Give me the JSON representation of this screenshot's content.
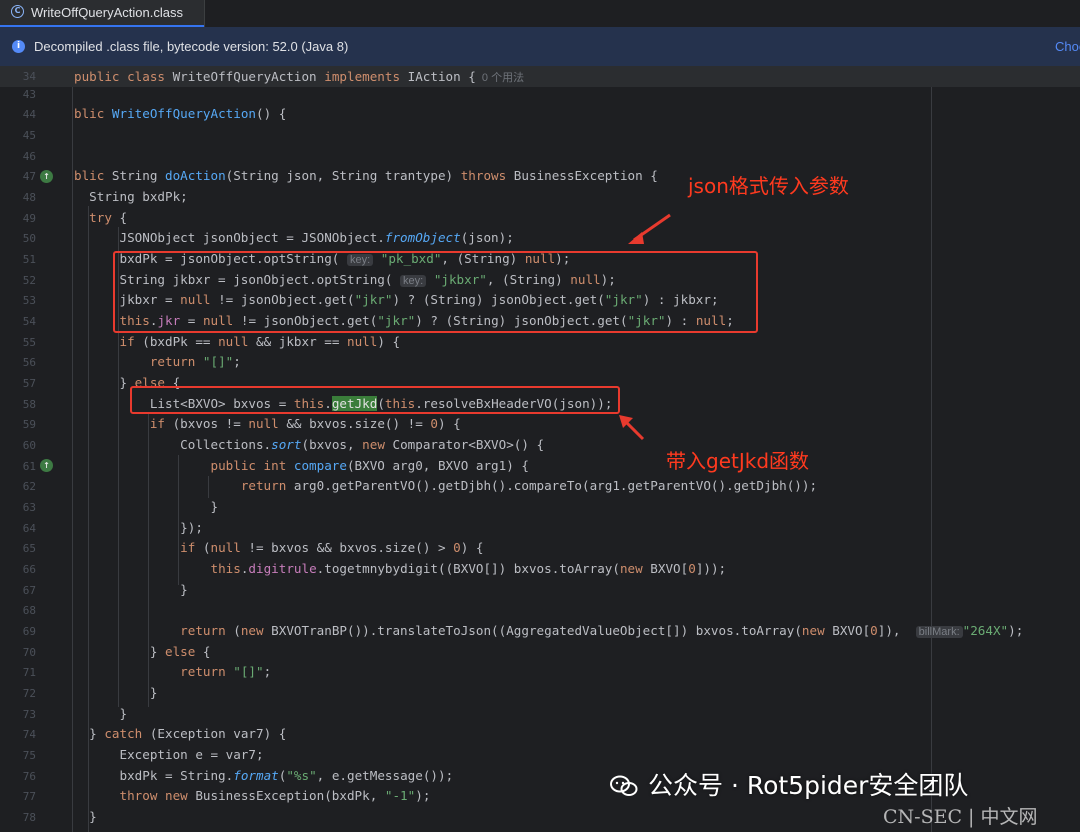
{
  "tab": {
    "title": "WriteOffQueryAction.class",
    "icon": "class-file-icon"
  },
  "infobar": {
    "text": "Decompiled .class file, bytecode version: 52.0 (Java 8)",
    "link": "Choose Sources..."
  },
  "sticky": {
    "line": "34",
    "usages": "0 个用法"
  },
  "lines": [
    {
      "n": "43"
    },
    {
      "n": "44"
    },
    {
      "n": "45"
    },
    {
      "n": "46"
    },
    {
      "n": "47"
    },
    {
      "n": "48"
    },
    {
      "n": "49"
    },
    {
      "n": "50"
    },
    {
      "n": "51"
    },
    {
      "n": "52"
    },
    {
      "n": "53"
    },
    {
      "n": "54"
    },
    {
      "n": "55"
    },
    {
      "n": "56"
    },
    {
      "n": "57"
    },
    {
      "n": "58"
    },
    {
      "n": "59"
    },
    {
      "n": "60"
    },
    {
      "n": "61"
    },
    {
      "n": "62"
    },
    {
      "n": "63"
    },
    {
      "n": "64"
    },
    {
      "n": "65"
    },
    {
      "n": "66"
    },
    {
      "n": "67"
    },
    {
      "n": "68"
    },
    {
      "n": "69"
    },
    {
      "n": "70"
    },
    {
      "n": "71"
    },
    {
      "n": "72"
    },
    {
      "n": "73"
    },
    {
      "n": "74"
    },
    {
      "n": "75"
    },
    {
      "n": "76"
    },
    {
      "n": "77"
    },
    {
      "n": "78"
    }
  ],
  "hints": {
    "key": "key:",
    "billMark": "billMark:"
  },
  "annotations": {
    "json_params": "json格式传入参数",
    "getjkd": "带入getJkd函数"
  },
  "watermark": {
    "text": "公众号 · Rot5pider安全团队",
    "site": "CN-SEC | 中文网"
  },
  "colors": {
    "keyword": "#cf8e6d",
    "function": "#56a8f5",
    "string": "#6aab73",
    "annotation_red": "#e83a2e"
  }
}
